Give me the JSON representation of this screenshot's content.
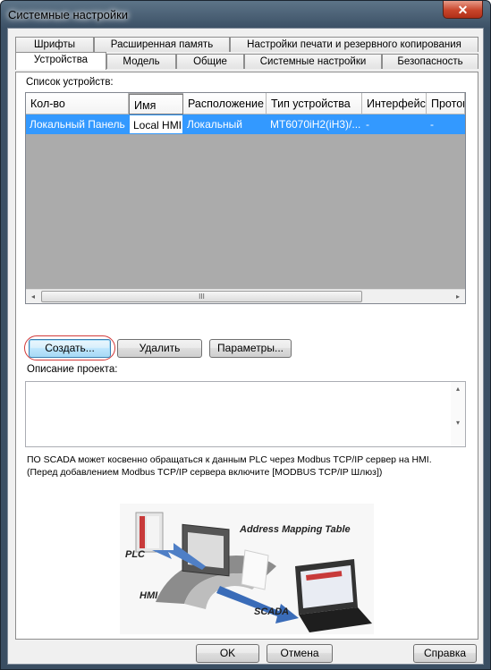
{
  "window": {
    "title": "Системные настройки",
    "close_glyph": "✕"
  },
  "tabs": {
    "row1": [
      "Шрифты",
      "Расширенная память",
      "Настройки печати и резервного копирования"
    ],
    "row2": [
      "Устройства",
      "Модель",
      "Общие",
      "Системные настройки",
      "Безопасность"
    ],
    "active": "Устройства"
  },
  "devices": {
    "label": "Список устройств:",
    "columns": [
      "Кол-во",
      "Имя",
      "Расположение",
      "Тип устройства",
      "Интерфейс",
      "Протон"
    ],
    "rows": [
      {
        "count": "Локальный Панель",
        "name": "Local HMI",
        "location": "Локальный",
        "type": "MT6070iH2(iH3)/...",
        "interface": "-",
        "protocol": "-"
      }
    ],
    "scroll_left": "◂",
    "scroll_right": "▸",
    "scroll_grip": "III"
  },
  "buttons": {
    "create": "Создать...",
    "delete": "Удалить",
    "params": "Параметры..."
  },
  "description": {
    "label": "Описание проекта:",
    "value": "",
    "scroll_up": "▴",
    "scroll_down": "▾"
  },
  "info": {
    "line1": "ПО SCADA может косвенно обращаться к данным PLC через Modbus TCP/IP сервер на HMI.",
    "line2": "(Перед добавлением Modbus TCP/IP сервера включите [MODBUS TCP/IP Шлюз])"
  },
  "diagram": {
    "title": "Address Mapping Table",
    "plc": "PLC",
    "hmi": "HMI",
    "scada": "SCADA",
    "icon": "address-mapping-diagram"
  },
  "footer": {
    "ok": "OK",
    "cancel": "Отмена",
    "help": "Справка"
  },
  "colors": {
    "selection": "#3399ff",
    "frame": "#3c5166",
    "highlight_ring": "#d23b3b"
  }
}
